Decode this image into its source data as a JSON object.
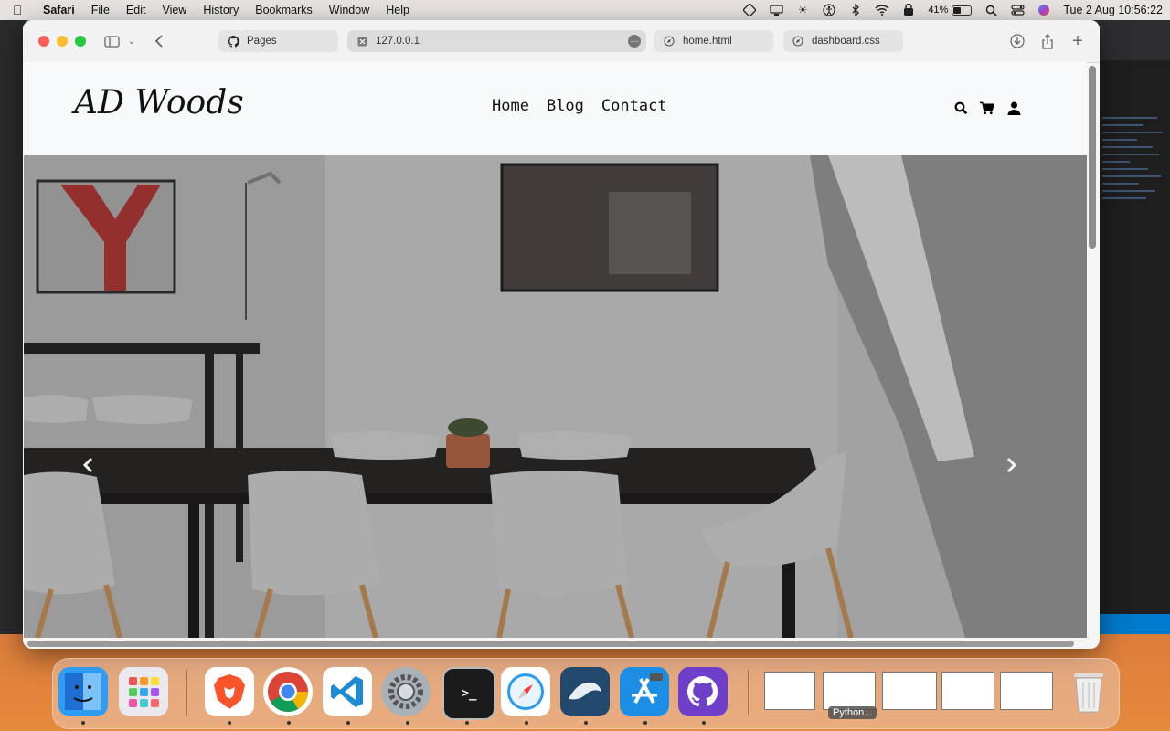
{
  "menubar": {
    "app_name": "Safari",
    "items": [
      "File",
      "Edit",
      "View",
      "History",
      "Bookmarks",
      "Window",
      "Help"
    ],
    "battery_percent": "41%",
    "clock": "Tue 2 Aug  10:56:22",
    "status_icons": [
      "gpu-icon",
      "display-icon",
      "brightness-icon",
      "accessibility-icon",
      "bluetooth-icon",
      "wifi-icon",
      "lock-icon",
      "battery-icon",
      "spotlight-icon",
      "control-center-icon",
      "siri-icon"
    ]
  },
  "browser": {
    "tabs": [
      {
        "label": "Pages",
        "icon": "github-icon"
      },
      {
        "label": "127.0.0.1",
        "icon": "close-icon",
        "active": true
      },
      {
        "label": "home.html",
        "icon": "compass-icon"
      },
      {
        "label": "dashboard.css",
        "icon": "compass-icon"
      }
    ]
  },
  "site": {
    "logo": "AD Woods",
    "nav": [
      "Home",
      "Blog",
      "Contact"
    ],
    "header_icons": [
      "search-icon",
      "cart-icon",
      "user-icon"
    ],
    "hero": {
      "prev_icon": "chevron-left-icon",
      "next_icon": "chevron-right-icon"
    }
  },
  "dock": {
    "apps": [
      {
        "name": "Finder",
        "color": "#2f9cf4"
      },
      {
        "name": "Launchpad",
        "color": "#e8e8ee"
      },
      {
        "name": "Brave",
        "color": "#fb542b"
      },
      {
        "name": "Chrome",
        "color": "#ffffff"
      },
      {
        "name": "VS Code",
        "color": "#ffffff"
      },
      {
        "name": "System Preferences",
        "color": "#9aa3ad"
      },
      {
        "name": "Terminal",
        "color": "#1b1b1b"
      },
      {
        "name": "Safari",
        "color": "#ffffff"
      },
      {
        "name": "MySQL Workbench",
        "color": "#23486e"
      },
      {
        "name": "Xcode",
        "color": "#1d8ee6"
      },
      {
        "name": "GitHub Desktop",
        "color": "#6e40c9"
      }
    ],
    "thumbnail_label": "Python..."
  }
}
